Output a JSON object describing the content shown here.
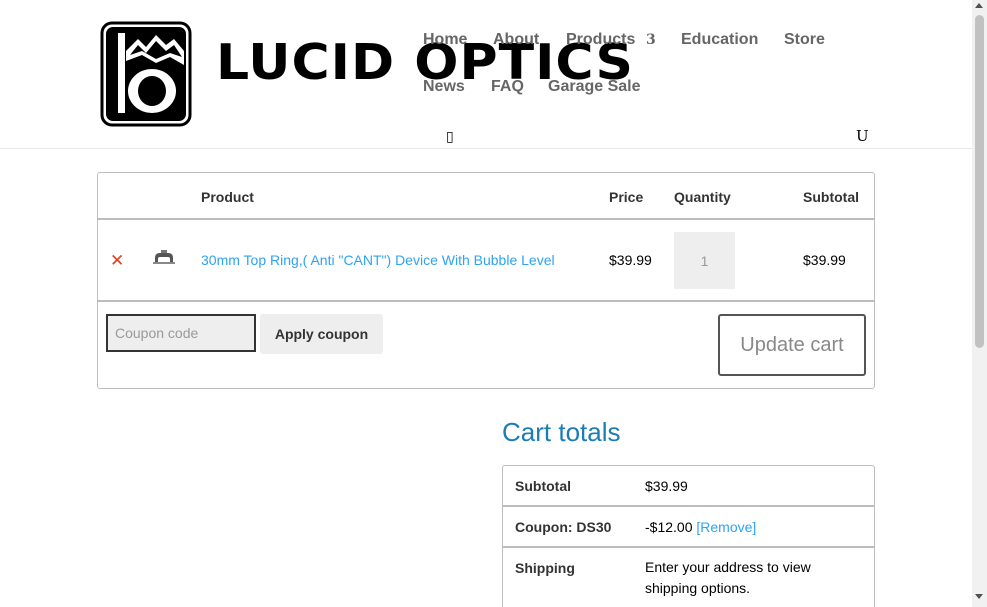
{
  "header": {
    "logo_text": "LUCID OPTICS",
    "nav": {
      "home": "Home",
      "about": "About",
      "products": "Products",
      "products_caret": "3",
      "education": "Education",
      "store": "Store",
      "news": "News",
      "faq": "FAQ",
      "garage_sale": "Garage Sale"
    },
    "icon_left_glyph": "▯",
    "icon_right_glyph": "U"
  },
  "cart": {
    "columns": {
      "product": "Product",
      "price": "Price",
      "quantity": "Quantity",
      "subtotal": "Subtotal"
    },
    "items": [
      {
        "name": "30mm Top Ring,( Anti \"CANT\") Device With Bubble Level",
        "price": "$39.99",
        "quantity": "1",
        "subtotal": "$39.99",
        "remove_glyph": "✕"
      }
    ],
    "coupon_placeholder": "Coupon code",
    "apply_coupon_label": "Apply coupon",
    "update_cart_label": "Update cart"
  },
  "totals": {
    "title": "Cart totals",
    "subtotal_label": "Subtotal",
    "subtotal_value": "$39.99",
    "coupon_label": "Coupon: DS30",
    "coupon_value": "-$12.00",
    "coupon_remove": "[Remove]",
    "shipping_label": "Shipping",
    "shipping_value": "Enter your address to view shipping options."
  },
  "colors": {
    "link": "#2ea3f2",
    "title": "#1a7db8",
    "remove": "#e2401c"
  }
}
